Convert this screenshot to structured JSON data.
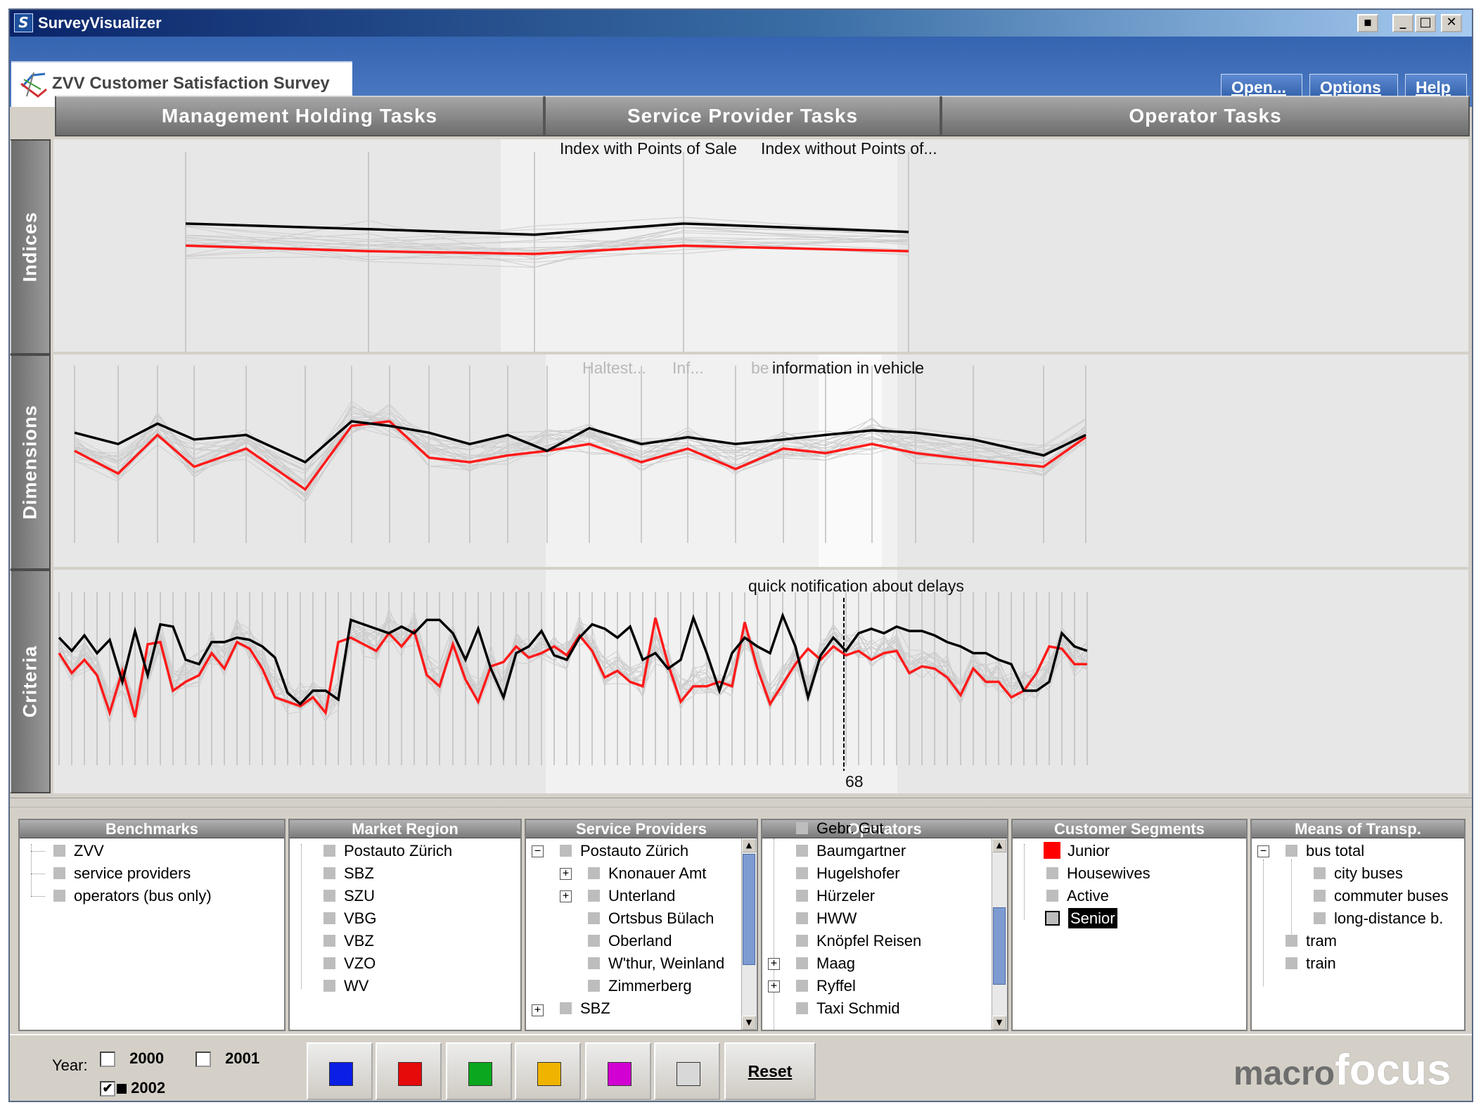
{
  "window": {
    "title": "SurveyVisualizer",
    "controls": [
      "▪",
      "_",
      "□",
      "✕"
    ]
  },
  "header": {
    "survey_title": "ZVV Customer Satisfaction Survey",
    "buttons": {
      "open": "Open...",
      "options": "Options",
      "help": "Help"
    }
  },
  "task_tabs": [
    "Management Holding Tasks",
    "Service Provider Tasks",
    "Operator Tasks"
  ],
  "side_tabs": [
    "Indices",
    "Dimensions",
    "Criteria"
  ],
  "plots": {
    "indices": {
      "labels": [
        "Index with Points of Sale",
        "Index without Points of..."
      ]
    },
    "dimensions": {
      "labels": [
        "Haltest...",
        "Inf...",
        "be",
        "information in vehicle"
      ]
    },
    "criteria": {
      "label": "quick notification about delays",
      "cursor_value": "68"
    }
  },
  "colors": {
    "black_series": "#000000",
    "red_series": "#ff1a1a",
    "context": "#c8c8c8"
  },
  "chart_data": {
    "type": "line",
    "indices": {
      "black": [
        0.76,
        0.74,
        0.72,
        0.76,
        0.73
      ],
      "red": [
        0.68,
        0.66,
        0.65,
        0.68,
        0.66
      ]
    },
    "dimensions": {
      "black": [
        0.73,
        0.68,
        0.77,
        0.7,
        0.72,
        0.6,
        0.78,
        0.76,
        0.73,
        0.68,
        0.72,
        0.65,
        0.75,
        0.68,
        0.71,
        0.68,
        0.7,
        0.72,
        0.74,
        0.73,
        0.7,
        0.63,
        0.72
      ],
      "red": [
        0.65,
        0.55,
        0.72,
        0.58,
        0.66,
        0.48,
        0.76,
        0.78,
        0.62,
        0.6,
        0.63,
        0.65,
        0.68,
        0.6,
        0.66,
        0.57,
        0.66,
        0.64,
        0.68,
        0.64,
        0.61,
        0.58,
        0.71
      ]
    },
    "criteria": {
      "black": [
        0.82,
        0.76,
        0.83,
        0.75,
        0.81,
        0.62,
        0.85,
        0.65,
        0.88,
        0.87,
        0.72,
        0.7,
        0.8,
        0.8,
        0.82,
        0.81,
        0.78,
        0.73,
        0.57,
        0.52,
        0.58,
        0.58,
        0.54,
        0.9,
        0.88,
        0.86,
        0.84,
        0.87,
        0.84,
        0.9,
        0.9,
        0.84,
        0.72,
        0.86,
        0.68,
        0.55,
        0.75,
        0.78,
        0.85,
        0.74,
        0.72,
        0.82,
        0.88,
        0.86,
        0.82,
        0.87,
        0.72,
        0.75,
        0.68,
        0.72,
        0.91,
        0.75,
        0.58,
        0.75,
        0.82,
        0.78,
        0.75,
        0.92,
        0.78,
        0.55,
        0.74,
        0.82,
        0.76,
        0.84,
        0.86,
        0.84,
        0.87,
        0.85,
        0.85,
        0.83,
        0.8,
        0.78,
        0.75,
        0.75,
        0.72,
        0.7,
        0.58,
        0.58,
        0.62,
        0.84,
        0.78,
        0.76
      ],
      "red": [
        0.75,
        0.66,
        0.72,
        0.65,
        0.48,
        0.67,
        0.46,
        0.79,
        0.8,
        0.58,
        0.62,
        0.65,
        0.75,
        0.68,
        0.8,
        0.77,
        0.68,
        0.55,
        0.53,
        0.51,
        0.55,
        0.48,
        0.8,
        0.82,
        0.79,
        0.76,
        0.84,
        0.78,
        0.85,
        0.65,
        0.6,
        0.79,
        0.63,
        0.53,
        0.69,
        0.71,
        0.78,
        0.73,
        0.75,
        0.78,
        0.74,
        0.83,
        0.76,
        0.64,
        0.67,
        0.62,
        0.6,
        0.91,
        0.7,
        0.53,
        0.6,
        0.6,
        0.62,
        0.6,
        0.89,
        0.68,
        0.52,
        0.61,
        0.7,
        0.77,
        0.72,
        0.78,
        0.74,
        0.76,
        0.72,
        0.75,
        0.76,
        0.66,
        0.69,
        0.68,
        0.64,
        0.56,
        0.68,
        0.62,
        0.62,
        0.55,
        0.58,
        0.66,
        0.78,
        0.77
      ]
    }
  },
  "filters": {
    "benchmarks": {
      "title": "Benchmarks",
      "items": [
        "ZVV",
        "service providers",
        "operators (bus only)"
      ]
    },
    "market_region": {
      "title": "Market Region",
      "items": [
        "Postauto Zürich",
        "SBZ",
        "SZU",
        "VBG",
        "VBZ",
        "VZO",
        "WV"
      ]
    },
    "service_providers": {
      "title": "Service Providers",
      "items": [
        "Postauto Zürich",
        "Knonauer Amt",
        "Unterland",
        "Ortsbus Bülach",
        "Oberland",
        "W'thur, Weinland",
        "Zimmerberg",
        "SBZ"
      ]
    },
    "operators": {
      "title": "Operators",
      "items": [
        "Gebr. Gut",
        "Baumgartner",
        "Hugelshofer",
        "Hürzeler",
        "HWW",
        "Knöpfel Reisen",
        "Maag",
        "Ryffel",
        "Taxi Schmid"
      ]
    },
    "customer_segments": {
      "title": "Customer Segments",
      "items": [
        "Junior",
        "Housewives",
        "Active",
        "Senior"
      ]
    },
    "means_of_transp": {
      "title": "Means of Transp.",
      "items": [
        "bus total",
        "city buses",
        "commuter buses",
        "long-distance b.",
        "tram",
        "train"
      ]
    }
  },
  "bottom": {
    "year_label": "Year:",
    "years": [
      "2000",
      "2001",
      "2002"
    ],
    "year_checked": [
      false,
      false,
      true
    ],
    "color_swatches": [
      "#0a1ee6",
      "#e60a0a",
      "#0aa81e",
      "#f0b400",
      "#d200d2",
      "#d8d8d8"
    ],
    "reset_label": "Reset",
    "brand_macro": "macro",
    "brand_focus": "focus"
  }
}
